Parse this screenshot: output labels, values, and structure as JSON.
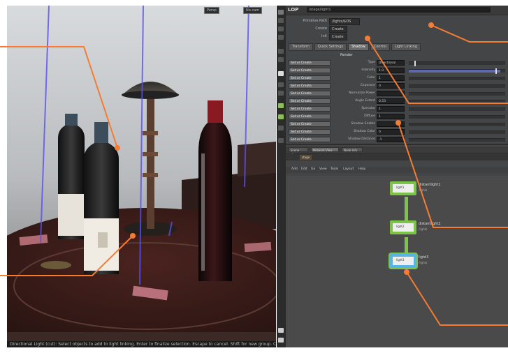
{
  "viewport": {
    "header_buttons": [
      "Persp",
      "No cam"
    ],
    "status_text": "Directional Light (cut): Select objects to add to light linking. Enter to finalize selection. Escape to cancel. Shift for new group. Click and drag for box select."
  },
  "panel": {
    "title": "LOP",
    "path": "/stage/light1",
    "fields": {
      "primitive_path_label": "Primitive Path",
      "primitive_path_value": "/lights/$OS",
      "create_label": "Create",
      "create_value": "Create",
      "init_label": "Init",
      "init_value": "Create"
    },
    "tabs": [
      "Transform",
      "Quick Settings",
      "Shadow",
      "Control",
      "Light Linking"
    ],
    "active_tab": "Shadow",
    "section_label": "Render",
    "rows": [
      {
        "chip": "Set or Create",
        "label": "Type",
        "value": "Directional",
        "fill": 0.0
      },
      {
        "chip": "Set or Create",
        "label": "Intensity",
        "value": "1.0",
        "fill": 0.95
      },
      {
        "chip": "Set or Create",
        "label": "Color",
        "value": "1",
        "fill": 0.0
      },
      {
        "chip": "Set or Create",
        "label": "Exposure",
        "value": "0",
        "fill": 0.0
      },
      {
        "chip": "Set or Create",
        "label": "Normalize Power",
        "value": "",
        "fill": 0.0
      },
      {
        "chip": "Set or Create",
        "label": "Angle Extent",
        "value": "0.53",
        "fill": 0.0
      },
      {
        "chip": "Set or Create",
        "label": "Specular",
        "value": "1",
        "fill": 0.0
      },
      {
        "chip": "Set or Create",
        "label": "Diffuse",
        "value": "1",
        "fill": 0.0
      },
      {
        "chip": "Set or Create",
        "label": "Shadow Enable",
        "value": "",
        "fill": 0.0
      },
      {
        "chip": "Set or Create",
        "label": "Shadow Color",
        "value": "0",
        "fill": 0.0
      },
      {
        "chip": "Set or Create",
        "label": "Shadow Distance",
        "value": "-1",
        "fill": 0.0
      }
    ],
    "extra_check_label": "Render"
  },
  "network": {
    "bar_items": [
      "Scene View",
      "Network View",
      "Node Info"
    ],
    "path_label": "stage",
    "menu": [
      "Add",
      "Edit",
      "Go",
      "View",
      "Tools",
      "Layout",
      "Help"
    ],
    "nodes": [
      {
        "label": "light1",
        "name": "distantlight1",
        "sub": "/lights"
      },
      {
        "label": "light2",
        "name": "distantlight2",
        "sub": "/lights"
      },
      {
        "label": "light3",
        "name": "light3",
        "sub": "/lights"
      }
    ]
  },
  "colors": {
    "annotation": "#f47c35",
    "node_border": "#7fc24a",
    "node_selected": "#59b4e6",
    "guide_line": "#5a4ff2"
  }
}
